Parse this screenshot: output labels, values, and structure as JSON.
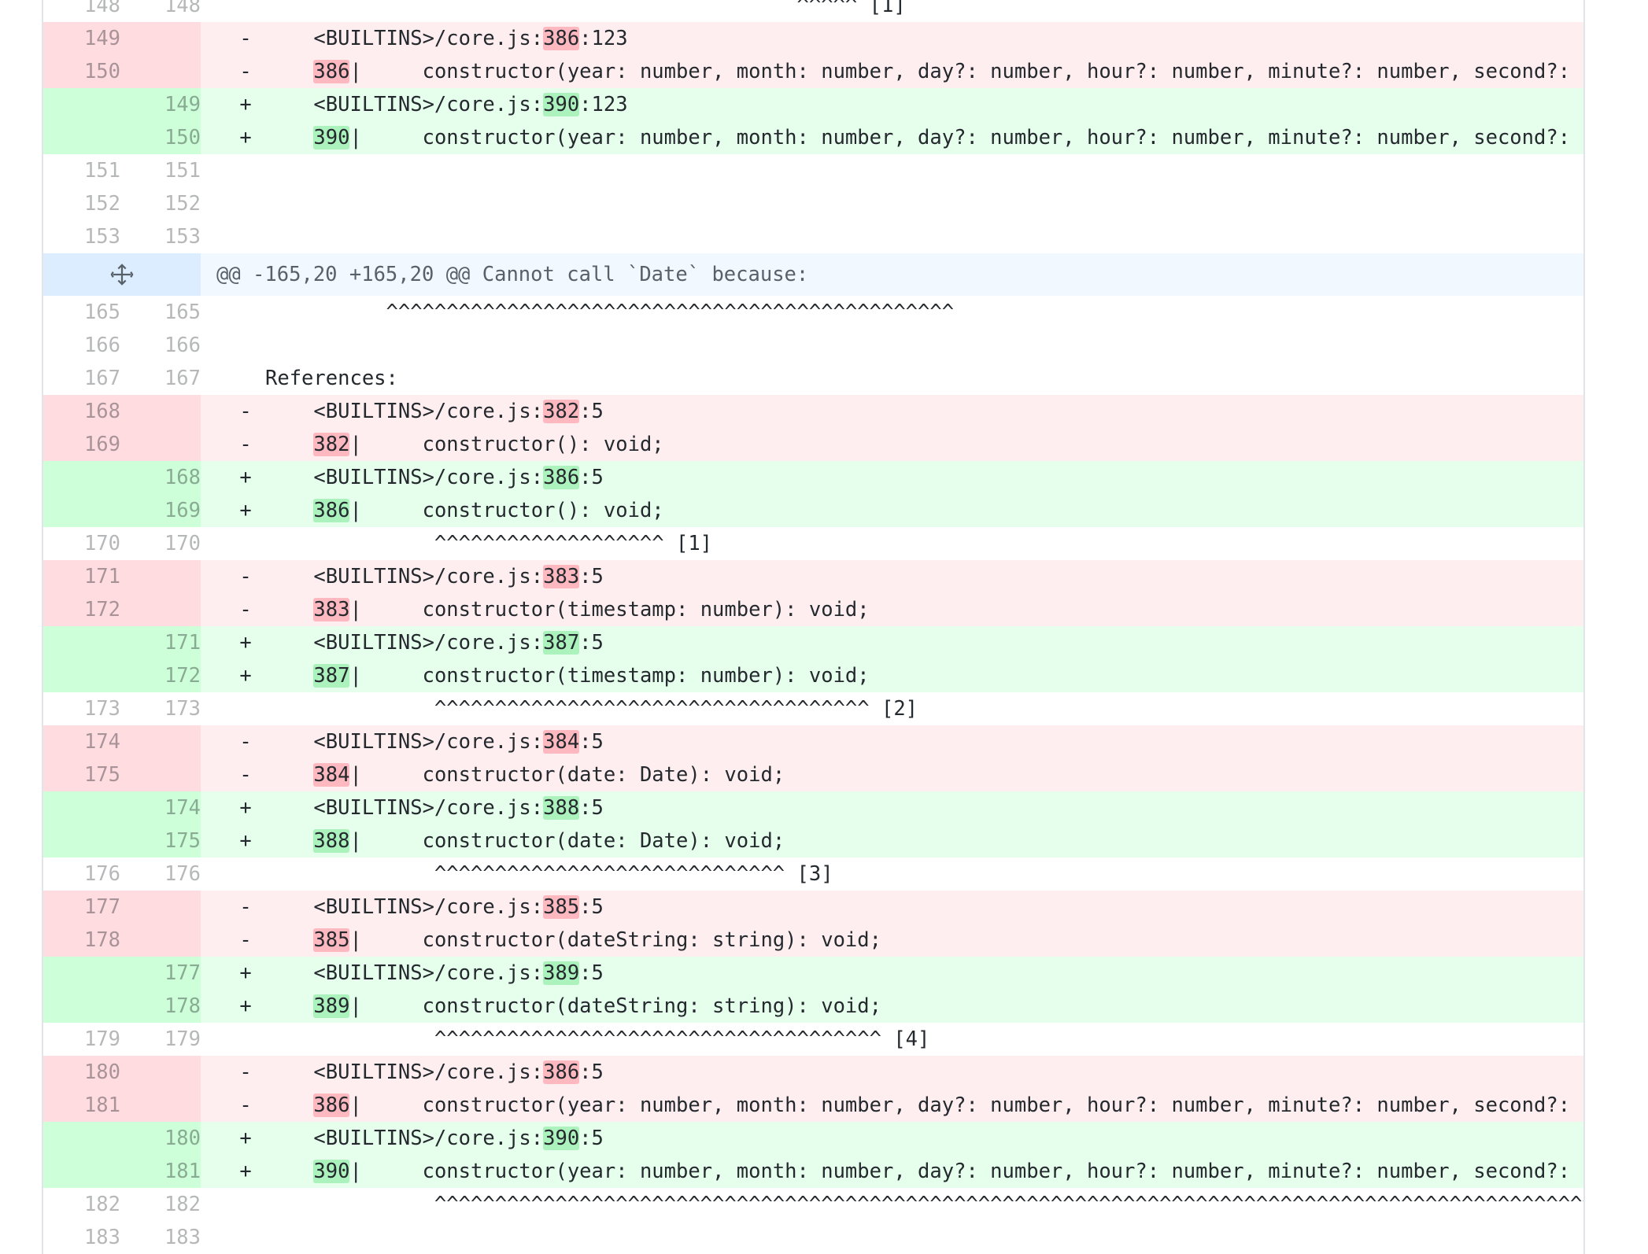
{
  "hunk": {
    "header": "@@ -165,20 +165,20 @@ Cannot call `Date` because:",
    "expand_icon": "unfold-icon"
  },
  "colors": {
    "deleted_bg": "#ffeef0",
    "deleted_gutter": "#ffdce0",
    "deleted_highlight": "#fdb8c0",
    "added_bg": "#e6ffed",
    "added_gutter": "#cdffd8",
    "added_highlight": "#acf2bd",
    "hunk_bg": "#f1f8ff"
  },
  "lines_top": [
    {
      "type": "ctx",
      "old": "148",
      "new": "148",
      "mark": "",
      "segs": [
        {
          "t": "                                            ^^^^^ [1]"
        }
      ]
    },
    {
      "type": "del",
      "old": "149",
      "new": "",
      "mark": "-",
      "segs": [
        {
          "t": "    <BUILTINS>/core.js:"
        },
        {
          "t": "386",
          "hl": true
        },
        {
          "t": ":123"
        }
      ]
    },
    {
      "type": "del",
      "old": "150",
      "new": "",
      "mark": "-",
      "segs": [
        {
          "t": "    "
        },
        {
          "t": "386",
          "hl": true
        },
        {
          "t": "|     constructor(year: number, month: number, day?: number, hour?: number, minute?: number, second?: number, millisecond?: number): void;"
        }
      ]
    },
    {
      "type": "add",
      "old": "",
      "new": "149",
      "mark": "+",
      "segs": [
        {
          "t": "    <BUILTINS>/core.js:"
        },
        {
          "t": "390",
          "hl": true
        },
        {
          "t": ":123"
        }
      ]
    },
    {
      "type": "add",
      "old": "",
      "new": "150",
      "mark": "+",
      "segs": [
        {
          "t": "    "
        },
        {
          "t": "390",
          "hl": true
        },
        {
          "t": "|     constructor(year: number, month: number, day?: number, hour?: number, minute?: number, second?: number, millisecond?: number): void;"
        }
      ]
    },
    {
      "type": "ctx",
      "old": "151",
      "new": "151",
      "mark": "",
      "segs": [
        {
          "t": ""
        }
      ]
    },
    {
      "type": "ctx",
      "old": "152",
      "new": "152",
      "mark": "",
      "segs": [
        {
          "t": ""
        }
      ]
    },
    {
      "type": "ctx",
      "old": "153",
      "new": "153",
      "mark": "",
      "segs": [
        {
          "t": ""
        }
      ]
    }
  ],
  "lines_bottom": [
    {
      "type": "ctx",
      "old": "165",
      "new": "165",
      "mark": "",
      "segs": [
        {
          "t": "          ^^^^^^^^^^^^^^^^^^^^^^^^^^^^^^^^^^^^^^^^^^^^^^^"
        }
      ]
    },
    {
      "type": "ctx",
      "old": "166",
      "new": "166",
      "mark": "",
      "segs": [
        {
          "t": ""
        }
      ]
    },
    {
      "type": "ctx",
      "old": "167",
      "new": "167",
      "mark": "",
      "segs": [
        {
          "t": "References:"
        }
      ]
    },
    {
      "type": "del",
      "old": "168",
      "new": "",
      "mark": "-",
      "segs": [
        {
          "t": "    <BUILTINS>/core.js:"
        },
        {
          "t": "382",
          "hl": true
        },
        {
          "t": ":5"
        }
      ]
    },
    {
      "type": "del",
      "old": "169",
      "new": "",
      "mark": "-",
      "segs": [
        {
          "t": "    "
        },
        {
          "t": "382",
          "hl": true
        },
        {
          "t": "|     constructor(): void;"
        }
      ]
    },
    {
      "type": "add",
      "old": "",
      "new": "168",
      "mark": "+",
      "segs": [
        {
          "t": "    <BUILTINS>/core.js:"
        },
        {
          "t": "386",
          "hl": true
        },
        {
          "t": ":5"
        }
      ]
    },
    {
      "type": "add",
      "old": "",
      "new": "169",
      "mark": "+",
      "segs": [
        {
          "t": "    "
        },
        {
          "t": "386",
          "hl": true
        },
        {
          "t": "|     constructor(): void;"
        }
      ]
    },
    {
      "type": "ctx",
      "old": "170",
      "new": "170",
      "mark": "",
      "segs": [
        {
          "t": "              ^^^^^^^^^^^^^^^^^^^ [1]"
        }
      ]
    },
    {
      "type": "del",
      "old": "171",
      "new": "",
      "mark": "-",
      "segs": [
        {
          "t": "    <BUILTINS>/core.js:"
        },
        {
          "t": "383",
          "hl": true
        },
        {
          "t": ":5"
        }
      ]
    },
    {
      "type": "del",
      "old": "172",
      "new": "",
      "mark": "-",
      "segs": [
        {
          "t": "    "
        },
        {
          "t": "383",
          "hl": true
        },
        {
          "t": "|     constructor(timestamp: number): void;"
        }
      ]
    },
    {
      "type": "add",
      "old": "",
      "new": "171",
      "mark": "+",
      "segs": [
        {
          "t": "    <BUILTINS>/core.js:"
        },
        {
          "t": "387",
          "hl": true
        },
        {
          "t": ":5"
        }
      ]
    },
    {
      "type": "add",
      "old": "",
      "new": "172",
      "mark": "+",
      "segs": [
        {
          "t": "    "
        },
        {
          "t": "387",
          "hl": true
        },
        {
          "t": "|     constructor(timestamp: number): void;"
        }
      ]
    },
    {
      "type": "ctx",
      "old": "173",
      "new": "173",
      "mark": "",
      "segs": [
        {
          "t": "              ^^^^^^^^^^^^^^^^^^^^^^^^^^^^^^^^^^^^ [2]"
        }
      ]
    },
    {
      "type": "del",
      "old": "174",
      "new": "",
      "mark": "-",
      "segs": [
        {
          "t": "    <BUILTINS>/core.js:"
        },
        {
          "t": "384",
          "hl": true
        },
        {
          "t": ":5"
        }
      ]
    },
    {
      "type": "del",
      "old": "175",
      "new": "",
      "mark": "-",
      "segs": [
        {
          "t": "    "
        },
        {
          "t": "384",
          "hl": true
        },
        {
          "t": "|     constructor(date: Date): void;"
        }
      ]
    },
    {
      "type": "add",
      "old": "",
      "new": "174",
      "mark": "+",
      "segs": [
        {
          "t": "    <BUILTINS>/core.js:"
        },
        {
          "t": "388",
          "hl": true
        },
        {
          "t": ":5"
        }
      ]
    },
    {
      "type": "add",
      "old": "",
      "new": "175",
      "mark": "+",
      "segs": [
        {
          "t": "    "
        },
        {
          "t": "388",
          "hl": true
        },
        {
          "t": "|     constructor(date: Date): void;"
        }
      ]
    },
    {
      "type": "ctx",
      "old": "176",
      "new": "176",
      "mark": "",
      "segs": [
        {
          "t": "              ^^^^^^^^^^^^^^^^^^^^^^^^^^^^^ [3]"
        }
      ]
    },
    {
      "type": "del",
      "old": "177",
      "new": "",
      "mark": "-",
      "segs": [
        {
          "t": "    <BUILTINS>/core.js:"
        },
        {
          "t": "385",
          "hl": true
        },
        {
          "t": ":5"
        }
      ]
    },
    {
      "type": "del",
      "old": "178",
      "new": "",
      "mark": "-",
      "segs": [
        {
          "t": "    "
        },
        {
          "t": "385",
          "hl": true
        },
        {
          "t": "|     constructor(dateString: string): void;"
        }
      ]
    },
    {
      "type": "add",
      "old": "",
      "new": "177",
      "mark": "+",
      "segs": [
        {
          "t": "    <BUILTINS>/core.js:"
        },
        {
          "t": "389",
          "hl": true
        },
        {
          "t": ":5"
        }
      ]
    },
    {
      "type": "add",
      "old": "",
      "new": "178",
      "mark": "+",
      "segs": [
        {
          "t": "    "
        },
        {
          "t": "389",
          "hl": true
        },
        {
          "t": "|     constructor(dateString: string): void;"
        }
      ]
    },
    {
      "type": "ctx",
      "old": "179",
      "new": "179",
      "mark": "",
      "segs": [
        {
          "t": "              ^^^^^^^^^^^^^^^^^^^^^^^^^^^^^^^^^^^^^ [4]"
        }
      ]
    },
    {
      "type": "del",
      "old": "180",
      "new": "",
      "mark": "-",
      "segs": [
        {
          "t": "    <BUILTINS>/core.js:"
        },
        {
          "t": "386",
          "hl": true
        },
        {
          "t": ":5"
        }
      ]
    },
    {
      "type": "del",
      "old": "181",
      "new": "",
      "mark": "-",
      "segs": [
        {
          "t": "    "
        },
        {
          "t": "386",
          "hl": true
        },
        {
          "t": "|     constructor(year: number, month: number, day?: number, hour?: number, minute?: number, second?: number, millisecond?: number): void;"
        }
      ]
    },
    {
      "type": "add",
      "old": "",
      "new": "180",
      "mark": "+",
      "segs": [
        {
          "t": "    <BUILTINS>/core.js:"
        },
        {
          "t": "390",
          "hl": true
        },
        {
          "t": ":5"
        }
      ]
    },
    {
      "type": "add",
      "old": "",
      "new": "181",
      "mark": "+",
      "segs": [
        {
          "t": "    "
        },
        {
          "t": "390",
          "hl": true
        },
        {
          "t": "|     constructor(year: number, month: number, day?: number, hour?: number, minute?: number, second?: number, millisecond?: number): void;"
        }
      ]
    },
    {
      "type": "ctx",
      "old": "182",
      "new": "182",
      "mark": "",
      "segs": [
        {
          "t": "              ^^^^^^^^^^^^^^^^^^^^^^^^^^^^^^^^^^^^^^^^^^^^^^^^^^^^^^^^^^^^^^^^^^^^^^^^^^^^^^^^^^^^^^^^^^^^^^^^^^^^^^^^^^^^^^^^^^^^^^^^^^^^^^^^^^"
        }
      ]
    },
    {
      "type": "ctx",
      "old": "183",
      "new": "183",
      "mark": "",
      "segs": [
        {
          "t": ""
        }
      ]
    }
  ]
}
